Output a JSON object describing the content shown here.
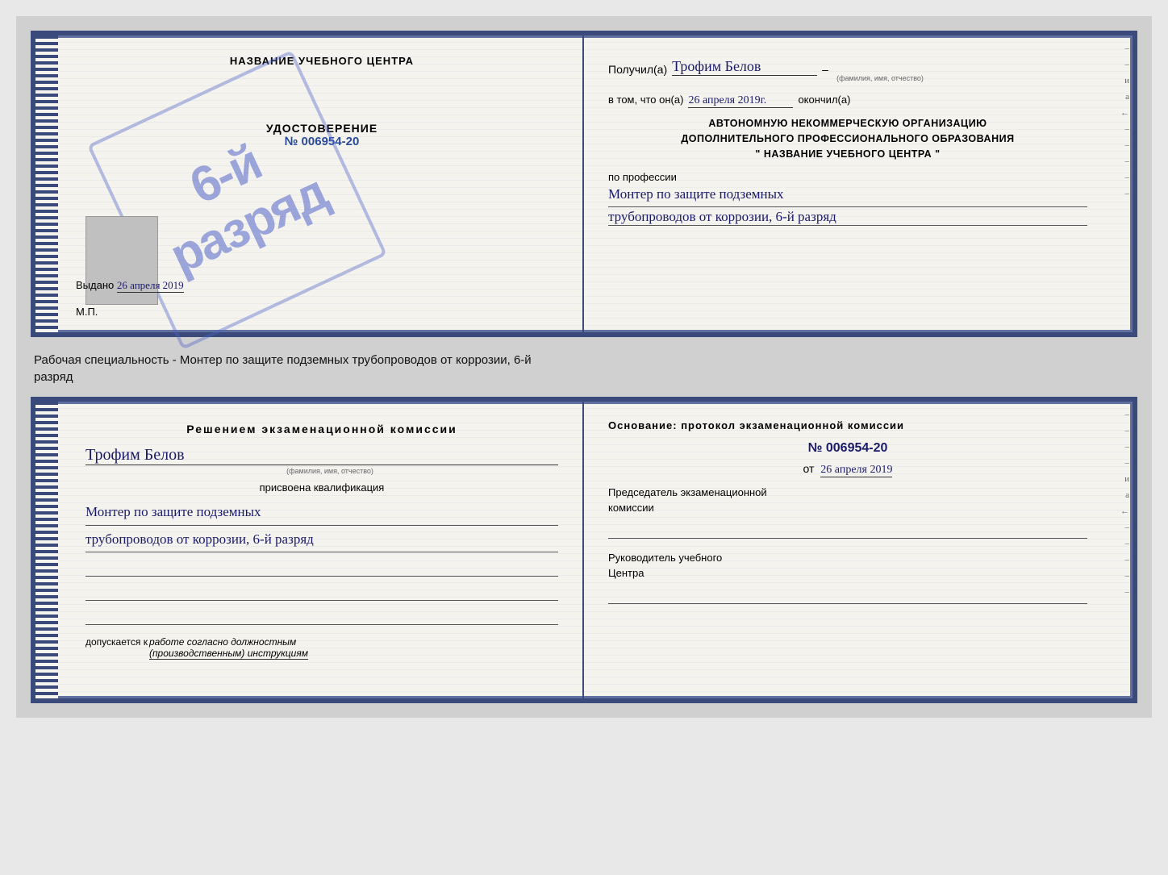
{
  "page": {
    "background": "#d0d0d0"
  },
  "top_doc": {
    "left": {
      "title": "НАЗВАНИЕ УЧЕБНОГО ЦЕНТРА",
      "stamp_text": "6-й разряд",
      "udostoverenie_label": "УДОСТОВЕРЕНИЕ",
      "number": "№ 006954-20",
      "vydano_label": "Выдано",
      "vydano_date": "26 апреля 2019",
      "mp_label": "М.П."
    },
    "right": {
      "poluchil_label": "Получил(a)",
      "name_handwritten": "Трофим Белов",
      "name_hint": "(фамилия, имя, отчество)",
      "dash": "–",
      "vtom_label": "в том, что он(а)",
      "date_handwritten": "26 апреля 2019г.",
      "okончил_label": "окончил(а)",
      "org_line1": "АВТОНОМНУЮ НЕКОММЕРЧЕСКУЮ ОРГАНИЗАЦИЮ",
      "org_line2": "ДОПОЛНИТЕЛЬНОГО ПРОФЕССИОНАЛЬНОГО ОБРАЗОВАНИЯ",
      "org_name_open": "\"",
      "org_name": "НАЗВАНИЕ УЧЕБНОГО ЦЕНТРА",
      "org_name_close": "\"",
      "po_professii": "по профессии",
      "profession_line1": "Монтер по защите подземных",
      "profession_line2": "трубопроводов от коррозии, 6-й разряд",
      "side_chars": [
        "–",
        "–",
        "и",
        "а",
        "←",
        "–",
        "–",
        "–",
        "–",
        "–"
      ]
    }
  },
  "between_label": {
    "text": "Рабочая специальность - Монтер по защите подземных трубопроводов от коррозии, 6-й",
    "text2": "разряд"
  },
  "bottom_doc": {
    "left": {
      "resheniem_line1": "Решением  экзаменационной  комиссии",
      "name_handwritten": "Трофим Белов",
      "name_hint": "(фамилия, имя, отчество)",
      "prisvoena": "присвоена квалификация",
      "profession_line1": "Монтер по защите подземных",
      "profession_line2": "трубопроводов от коррозии, 6-й разряд",
      "blank_lines": 3,
      "dopuskaetsya_prefix": "допускается к",
      "dopuskaetsya_text": "работе согласно должностным",
      "dopuskaetsya_text2": "(производственным) инструкциям"
    },
    "right": {
      "osnovanie_label": "Основание: протокол экзаменационной  комиссии",
      "number": "№  006954-20",
      "ot_label": "от",
      "ot_date": "26 апреля 2019",
      "predsedatel_line1": "Председатель экзаменационной",
      "predsedatel_line2": "комиссии",
      "rukovoditel_line1": "Руководитель учебного",
      "rukovoditel_line2": "Центра",
      "side_chars": [
        "–",
        "–",
        "–",
        "–",
        "и",
        "а",
        "←",
        "–",
        "–",
        "–",
        "–",
        "–"
      ]
    }
  }
}
